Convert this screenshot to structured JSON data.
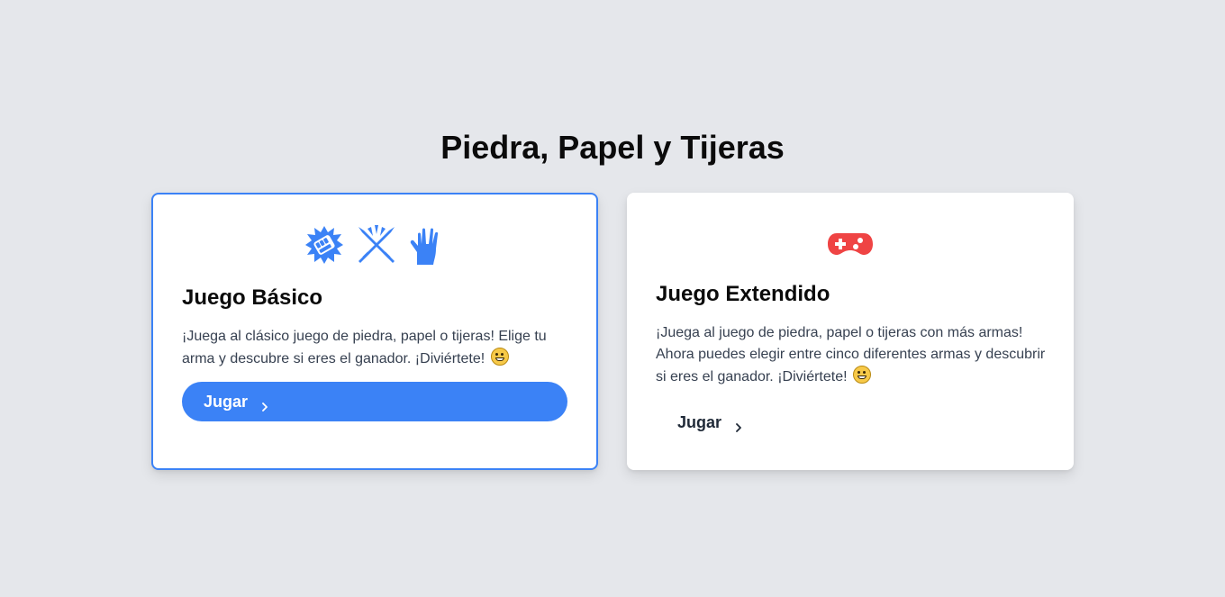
{
  "page": {
    "title": "Piedra, Papel y Tijeras"
  },
  "cards": {
    "basic": {
      "title": "Juego Básico",
      "description": "¡Juega al clásico juego de piedra, papel o tijeras! Elige tu arma y descubre si eres el ganador. ¡Diviértete!",
      "button_label": "Jugar",
      "icons": [
        "fist-icon",
        "crossed-blades-icon",
        "spock-hand-icon"
      ],
      "selected": true
    },
    "extended": {
      "title": "Juego Extendido",
      "description": "¡Juega al juego de piedra, papel o tijeras con más armas! Ahora puedes elegir entre cinco diferentes armas y descubrir si eres el ganador. ¡Diviértete!",
      "button_label": "Jugar",
      "icons": [
        "gamepad-icon"
      ],
      "selected": false
    }
  },
  "colors": {
    "background": "#e5e7eb",
    "accent": "#3b82f6",
    "gamepad": "#ef4444"
  }
}
